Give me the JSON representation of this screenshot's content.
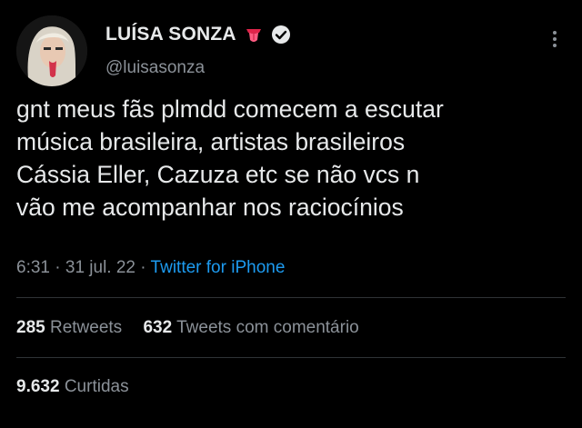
{
  "user": {
    "name": "LUÍSA SONZA",
    "handle": "@luisasonza",
    "name_emoji": "tongue-emoji-icon",
    "verified": true
  },
  "tweet": {
    "text": "gnt meus fãs plmdd comecem a escutar\nmúsica brasileira, artistas brasileiros\nCássia Eller, Cazuza etc se não vcs n\nvão me acompanhar nos raciocínios",
    "time": "6:31",
    "date": "31 jul. 22",
    "source": "Twitter for iPhone"
  },
  "stats": {
    "retweets_count": "285",
    "retweets_label": "Retweets",
    "quotes_count": "632",
    "quotes_label": "Tweets com comentário",
    "likes_count": "9.632",
    "likes_label": "Curtidas"
  },
  "colors": {
    "background": "#000000",
    "text": "#e7e9ea",
    "muted": "#8b9198",
    "link": "#1d9bf0",
    "divider": "#2f3336"
  }
}
